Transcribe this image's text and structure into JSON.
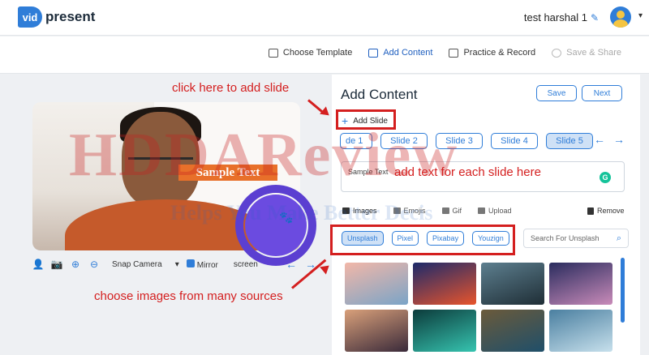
{
  "header": {
    "logo_mark": "vid",
    "logo_text": "present",
    "user_name": "test harshal 1",
    "edit_icon": "pencil-icon",
    "avatar_icon": "user-avatar",
    "menu_icon": "chevron-down-icon"
  },
  "steps": [
    {
      "label": "Choose Template",
      "state": "default"
    },
    {
      "label": "Add Content",
      "state": "active"
    },
    {
      "label": "Practice & Record",
      "state": "default"
    },
    {
      "label": "Save & Share",
      "state": "disabled"
    }
  ],
  "camera": {
    "overlay_text": "Sample Text",
    "toolbar": {
      "camera_source": "Snap Camera",
      "mirror_label": "Mirror",
      "mirror_checked": true,
      "screen_label": "screen"
    }
  },
  "panel": {
    "title": "Add Content",
    "save_label": "Save",
    "next_label": "Next",
    "add_slide_label": "Add Slide",
    "slides": [
      "de 1",
      "Slide 2",
      "Slide 3",
      "Slide 4",
      "Slide 5"
    ],
    "active_slide": "Slide 5",
    "text_value": "Sample Text",
    "media_tabs": [
      "Images",
      "Emojis",
      "Gif",
      "Upload"
    ],
    "active_media_tab": "Images",
    "remove_label": "Remove",
    "sources": [
      "Unsplash",
      "Pixel",
      "Pixabay",
      "Youzign"
    ],
    "active_source": "Unsplash",
    "search_placeholder": "Search For Unsplash",
    "thumbnails": [
      {
        "colors": [
          "#f2b7a8",
          "#7aa4c7"
        ]
      },
      {
        "colors": [
          "#1c2a6b",
          "#e8542c"
        ]
      },
      {
        "colors": [
          "#5d7f8f",
          "#1f2e36"
        ]
      },
      {
        "colors": [
          "#2a2c5e",
          "#c98bb9"
        ]
      },
      {
        "colors": [
          "#d9a07a",
          "#3a2a3a"
        ]
      },
      {
        "colors": [
          "#0c3b3b",
          "#36c4b0"
        ]
      },
      {
        "colors": [
          "#6b5a3a",
          "#1f4f6a"
        ]
      },
      {
        "colors": [
          "#4a7fa0",
          "#c7e0ec"
        ]
      }
    ]
  },
  "annotations": {
    "add_slide": "click here to add slide",
    "add_text": "add text for each slide here",
    "images": "choose images from many sources"
  },
  "watermark": {
    "main": "HDDAReview",
    "sub": "Helps You Make Better Decis"
  }
}
